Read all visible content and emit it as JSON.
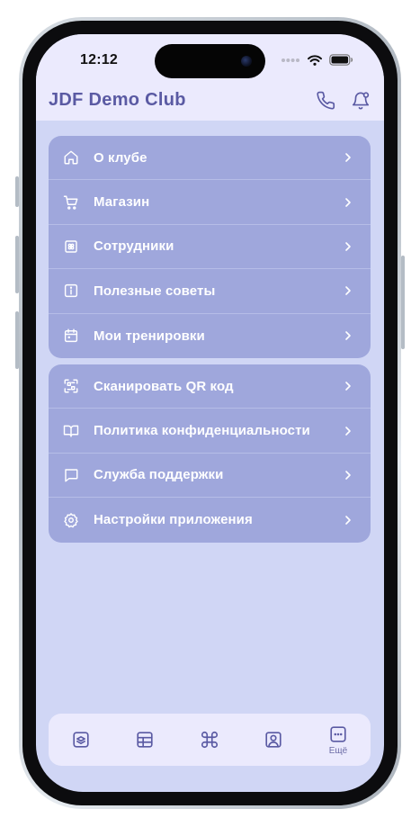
{
  "status_bar": {
    "time": "12:12"
  },
  "header": {
    "title": "JDF Demo Club",
    "icons": [
      "phone-icon",
      "bell-icon"
    ]
  },
  "menu_group_1": [
    {
      "label": "О клубе",
      "icon": "home-icon"
    },
    {
      "label": "Магазин",
      "icon": "cart-icon"
    },
    {
      "label": "Сотрудники",
      "icon": "staff-icon"
    },
    {
      "label": "Полезные советы",
      "icon": "info-icon"
    },
    {
      "label": "Мои тренировки",
      "icon": "calendar-icon"
    }
  ],
  "menu_group_2": [
    {
      "label": "Сканировать QR код",
      "icon": "qr-scan-icon"
    },
    {
      "label": "Политика конфиденциальности",
      "icon": "book-icon"
    },
    {
      "label": "Служба поддержки",
      "icon": "chat-icon"
    },
    {
      "label": "Настройки приложения",
      "icon": "settings-icon"
    }
  ],
  "tabbar": {
    "tabs": [
      {
        "icon": "layers-icon"
      },
      {
        "icon": "grid-icon"
      },
      {
        "icon": "command-icon"
      },
      {
        "icon": "profile-icon"
      },
      {
        "icon": "more-icon",
        "label": "Ещё",
        "active": true
      }
    ]
  },
  "colors": {
    "accent": "#5a5aa3",
    "menu_bg": "#9fa7dc",
    "screen_bg": "#d0d6f5",
    "bar_bg": "#ebeafd"
  }
}
